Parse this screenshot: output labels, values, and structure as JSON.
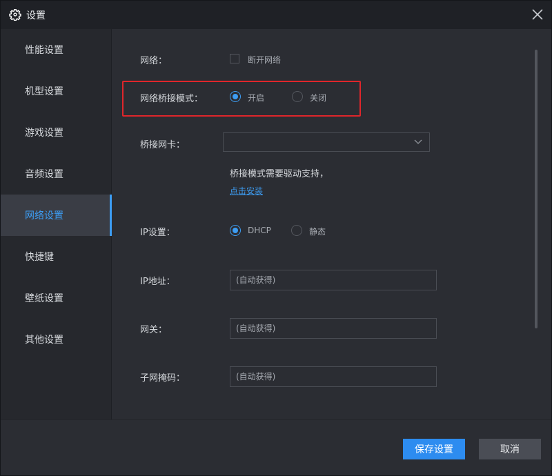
{
  "window": {
    "title": "设置"
  },
  "sidebar": {
    "items": [
      {
        "label": "性能设置"
      },
      {
        "label": "机型设置"
      },
      {
        "label": "游戏设置"
      },
      {
        "label": "音频设置"
      },
      {
        "label": "网络设置",
        "active": true
      },
      {
        "label": "快捷键"
      },
      {
        "label": "壁纸设置"
      },
      {
        "label": "其他设置"
      }
    ]
  },
  "network": {
    "network_label": "网络：",
    "disconnect_label": "断开网络",
    "bridge_mode_label": "网络桥接模式：",
    "bridge_on": "开启",
    "bridge_off": "关闭",
    "bridge_nic_label": "桥接网卡：",
    "bridge_nic_value": "",
    "driver_note": "桥接模式需要驱动支持，",
    "install_link": "点击安装",
    "ip_setting_label": "IP设置：",
    "ip_dhcp": "DHCP",
    "ip_static": "静态",
    "ip_address_label": "IP地址：",
    "ip_address_placeholder": "(自动获得)",
    "gateway_label": "网关：",
    "gateway_placeholder": "(自动获得)",
    "subnet_label": "子网掩码：",
    "subnet_placeholder": "(自动获得)"
  },
  "footer": {
    "save_label": "保存设置",
    "cancel_label": "取消"
  },
  "colors": {
    "accent": "#2d8cf0",
    "highlight": "#e0262b",
    "background": "#2b2d33"
  }
}
